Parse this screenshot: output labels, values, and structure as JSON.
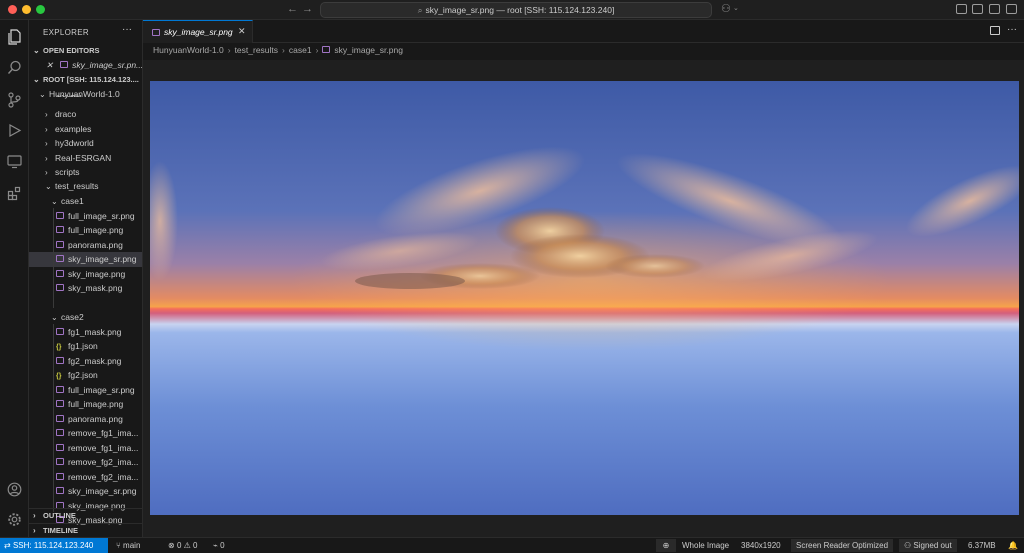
{
  "window": {
    "title": "sky_image_sr.png — root [SSH: 115.124.123.240]"
  },
  "activity_bar": {
    "icons": [
      "files-icon",
      "search-icon",
      "source-control-icon",
      "run-debug-icon",
      "remote-explorer-icon",
      "extensions-icon",
      "account-icon",
      "manage-gear-icon"
    ]
  },
  "sidebar": {
    "title": "EXPLORER",
    "open_editors": {
      "label": "OPEN EDITORS",
      "items": [
        {
          "name": "sky_image_sr.pn..."
        }
      ]
    },
    "root": {
      "label": "ROOT [SSH: 115.124.123....",
      "project": "HunyuanWorld-1.0",
      "folders_partial": "docker",
      "folders": [
        "draco",
        "examples",
        "hy3dworld",
        "Real-ESRGAN",
        "scripts"
      ],
      "test_results": "test_results",
      "case1": {
        "label": "case1",
        "files": [
          "full_image_sr.png",
          "full_image.png",
          "panorama.png",
          "sky_image_sr.png",
          "sky_image.png",
          "sky_mask.png"
        ]
      },
      "case2": {
        "label": "case2",
        "files": [
          "fg1_mask.png",
          "fg1.json",
          "fg2_mask.png",
          "fg2.json",
          "full_image_sr.png",
          "full_image.png",
          "panorama.png",
          "remove_fg1_ima...",
          "remove_fg1_ima...",
          "remove_fg2_ima...",
          "remove_fg2_ima...",
          "sky_image_sr.png",
          "sky_image.png",
          "sky_mask.png"
        ]
      }
    },
    "outline_label": "OUTLINE",
    "timeline_label": "TIMELINE"
  },
  "editor": {
    "tab_label": "sky_image_sr.png",
    "breadcrumb": [
      "HunyuanWorld-1.0",
      "test_results",
      "case1",
      "sky_image_sr.png"
    ]
  },
  "status_bar": {
    "remote": "SSH: 115.124.123.240",
    "branch": "main",
    "errors": "0",
    "warnings": "0",
    "ports": "0",
    "zoom": "Whole Image",
    "dimensions": "3840x1920",
    "screen_reader": "Screen Reader Optimized",
    "account": "Signed out",
    "file_size": "6.37MB"
  },
  "colors": {
    "accent": "#0078d4",
    "image_icon": "#a074c4",
    "json_icon": "#cbcb41"
  }
}
